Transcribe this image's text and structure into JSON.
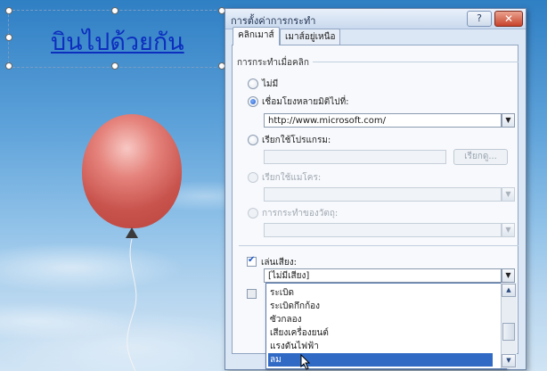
{
  "slide": {
    "title": "บินไปด้วยกัน"
  },
  "dialog": {
    "title": "การตั้งค่าการกระทำ",
    "help_label": "?",
    "close_label": "✕",
    "tabs": [
      {
        "label": "คลิกเมาส์",
        "active": true
      },
      {
        "label": "เมาส์อยู่เหนือ",
        "active": false
      }
    ],
    "group_label": "การกระทำเมื่อคลิก",
    "options": {
      "none": "ไม่มี",
      "hyperlink": "เชื่อมโยงหลายมิติไปที่:",
      "run_program": "เรียกใช้โปรแกรม:",
      "run_macro": "เรียกใช้แมโคร:",
      "object_action": "การกระทำของวัตถุ:"
    },
    "selected_option": "hyperlink",
    "hyperlink_value": "http://www.microsoft.com/",
    "run_program_value": "",
    "browse_label": "เรียกดู...",
    "play_sound": {
      "label": "เล่นเสียง:",
      "checked": true,
      "value": "[ไม่มีเสียง]",
      "options": [
        "ระเบิด",
        "ระเบิดกึกก้อง",
        "ซัวกลอง",
        "เสียงเครื่องยนต์",
        "แรงดันไฟฟ้า",
        "ลม"
      ],
      "highlighted": "ลม"
    },
    "highlight_click_checked": false,
    "arrow_glyph": "▼",
    "scroll_up_glyph": "▲",
    "scroll_down_glyph": "▼"
  }
}
